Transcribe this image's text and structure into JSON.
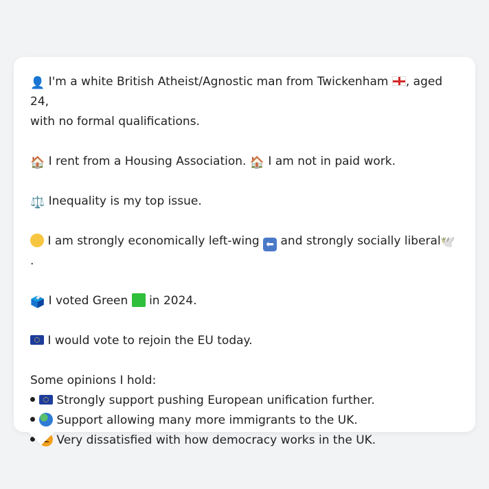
{
  "profile": {
    "line1_part1": "I'm a white British Atheist/Agnostic man from Twickenham",
    "line1_part2": ", aged 24,",
    "line2": "with no formal qualifications.",
    "housing_a": "I rent from a Housing Association.",
    "housing_b": "I am not in paid work.",
    "issue": "Inequality is my top issue.",
    "ideology_a": "I am strongly economically left-wing",
    "ideology_b": "and strongly socially liberal",
    "ideology_end": ".",
    "vote_a": "I voted Green",
    "vote_b": "in 2024.",
    "eu": "I would vote to rejoin the EU today."
  },
  "opinions": {
    "heading": "Some opinions I hold:",
    "items": [
      "Strongly support pushing European unification further.",
      "Support allowing many more immigrants to the UK.",
      "Very dissatisfied with how democracy works in the UK."
    ]
  },
  "icons": {
    "person": "👤",
    "house": "🏠",
    "scales": "⚖️",
    "thinking": "🤔",
    "left_arrow": "⬅",
    "dove": "🕊️",
    "ballot": "🗳️",
    "globe": "🌍",
    "angry": "😠"
  },
  "colors": {
    "background": "#f2f3f5",
    "card": "#ffffff",
    "text": "#222222",
    "green": "#2fbf3a",
    "eu_blue": "#1d3c9c"
  }
}
